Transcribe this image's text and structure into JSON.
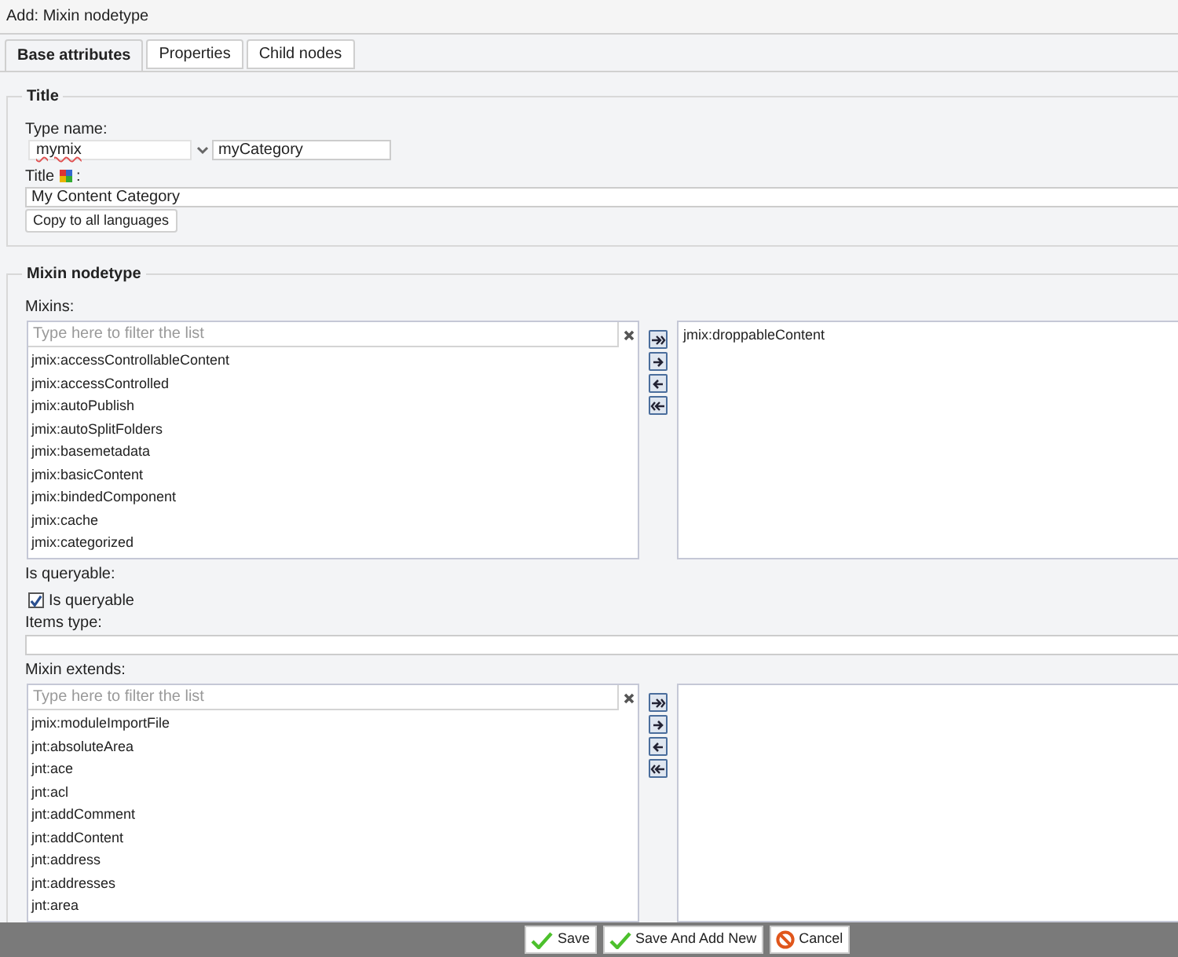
{
  "window": {
    "title": "Add: Mixin nodetype"
  },
  "tabs": [
    {
      "label": "Base attributes",
      "selected": true
    },
    {
      "label": "Properties",
      "selected": false
    },
    {
      "label": "Child nodes",
      "selected": false
    }
  ],
  "title_section": {
    "legend": "Title",
    "type_name_label": "Type name:",
    "type_prefix": "mymix",
    "type_name": "myCategory",
    "title_label": "Title",
    "title_colon": ":",
    "title_value": "My Content Category",
    "copy_button": "Copy to all languages"
  },
  "mixin_section": {
    "legend": "Mixin nodetype",
    "mixins": {
      "label": "Mixins:",
      "placeholder": "Type here to filter the list",
      "available": [
        "jmix:accessControllableContent",
        "jmix:accessControlled",
        "jmix:autoPublish",
        "jmix:autoSplitFolders",
        "jmix:basemetadata",
        "jmix:basicContent",
        "jmix:bindedComponent",
        "jmix:cache",
        "jmix:categorized"
      ],
      "chosen": [
        "jmix:droppableContent"
      ]
    },
    "queryable": {
      "label": "Is queryable:",
      "checkbox_label": "Is queryable",
      "checked": true
    },
    "items_type": {
      "label": "Items type:"
    },
    "mixin_extends": {
      "label": "Mixin extends:",
      "placeholder": "Type here to filter the list",
      "available": [
        "jmix:moduleImportFile",
        "jnt:absoluteArea",
        "jnt:ace",
        "jnt:acl",
        "jnt:addComment",
        "jnt:addContent",
        "jnt:address",
        "jnt:addresses",
        "jnt:area"
      ]
    }
  },
  "buttons": [
    {
      "label": "Save",
      "kind": "save"
    },
    {
      "label": "Save And Add New",
      "kind": "save"
    },
    {
      "label": "Cancel",
      "kind": "cancel"
    }
  ]
}
